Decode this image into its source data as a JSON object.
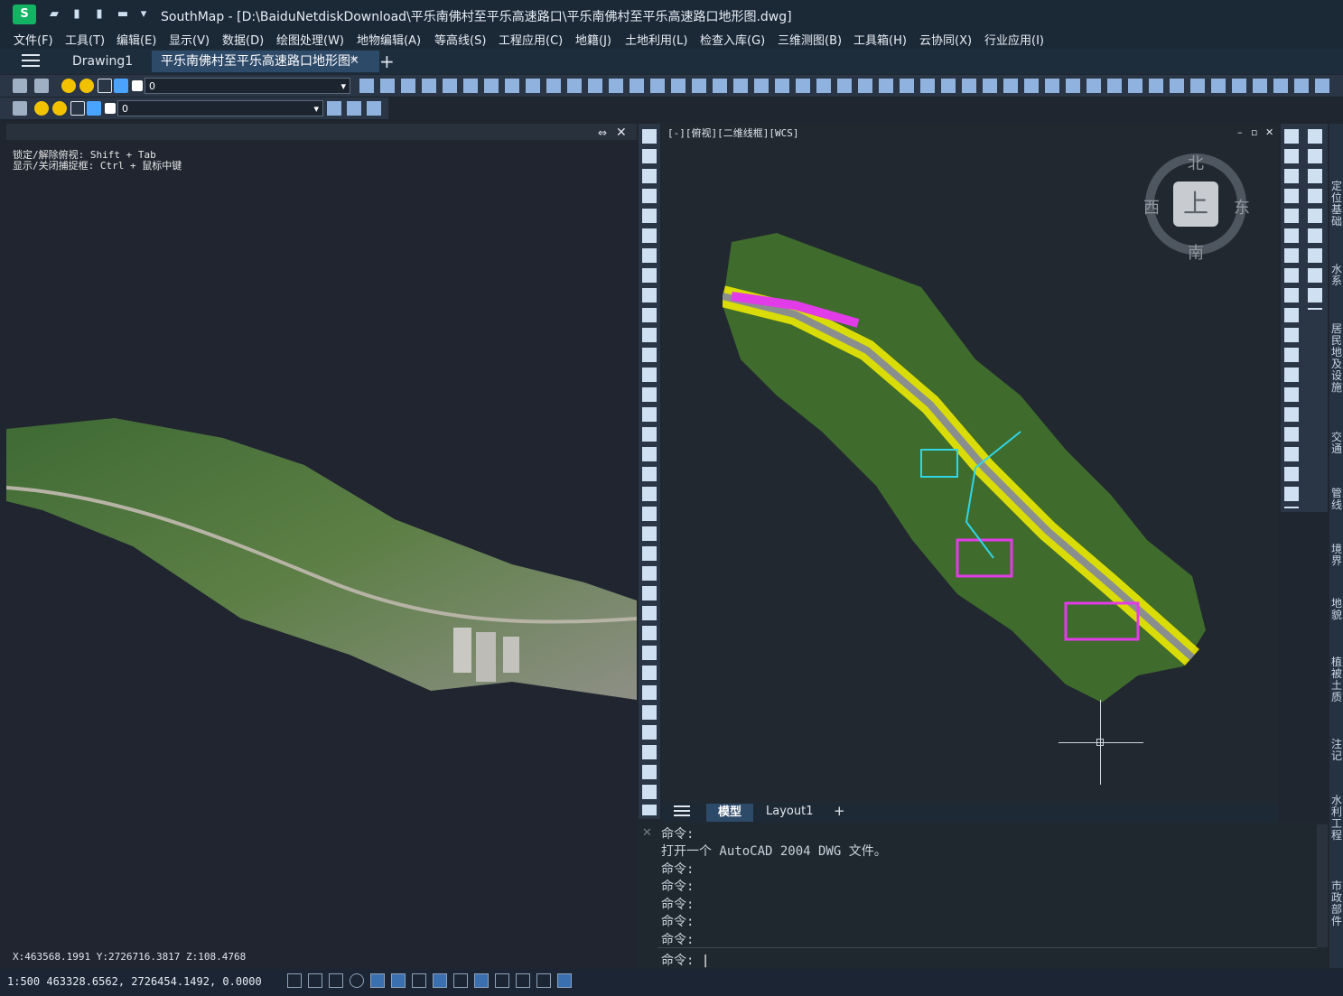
{
  "title": {
    "app_name": "SouthMap",
    "text": "SouthMap - [D:\\BaiduNetdiskDownload\\平乐南佛村至平乐高速路口\\平乐南佛村至平乐高速路口地形图.dwg]"
  },
  "menu": [
    {
      "label": "文件(F)"
    },
    {
      "label": "工具(T)"
    },
    {
      "label": "编辑(E)"
    },
    {
      "label": "显示(V)"
    },
    {
      "label": "数据(D)"
    },
    {
      "label": "绘图处理(W)"
    },
    {
      "label": "地物编辑(A)"
    },
    {
      "label": "等高线(S)"
    },
    {
      "label": "工程应用(C)"
    },
    {
      "label": "地籍(J)"
    },
    {
      "label": "土地利用(L)"
    },
    {
      "label": "检查入库(G)"
    },
    {
      "label": "三维测图(B)"
    },
    {
      "label": "工具箱(H)"
    },
    {
      "label": "云协同(X)"
    },
    {
      "label": "行业应用(I)"
    }
  ],
  "doc_tabs": {
    "tab1": "Drawing1",
    "tab2": "平乐南佛村至平乐高速路口地形图*",
    "close": "✕",
    "add": "+"
  },
  "toolbar": {
    "layer_value": "0",
    "layer_value_2": "0"
  },
  "left_view": {
    "hint1": "锁定/解除俯视: Shift + Tab",
    "hint2": "显示/关闭捕捉框: Ctrl + 鼠标中键",
    "coords": "X:463568.1991  Y:2726716.3817  Z:108.4768"
  },
  "right_view": {
    "header": "[-][俯视][二维线框][WCS]",
    "compass": {
      "north": "北",
      "south": "南",
      "east": "东",
      "west": "西",
      "center": "上"
    }
  },
  "layout_tabs": {
    "model": "模型",
    "layout1": "Layout1",
    "add": "+"
  },
  "command": {
    "lines": [
      "命令:",
      "打开一个 AutoCAD 2004 DWG 文件。",
      "命令:",
      "命令:",
      "命令:",
      "命令:",
      "命令:"
    ],
    "prompt": "命令:"
  },
  "status": {
    "text": "1:500 463328.6562, 2726454.1492, 0.0000"
  },
  "far_right_panel": [
    "定位基础",
    "水系",
    "居民地及设施",
    "交通",
    "管线",
    "境界",
    "地貌",
    "植被土质",
    "注记",
    "水利工程",
    "市政部件"
  ],
  "colors": {
    "accent": "#2e4a69",
    "bg": "#1f2630",
    "logo": "#12b463"
  }
}
